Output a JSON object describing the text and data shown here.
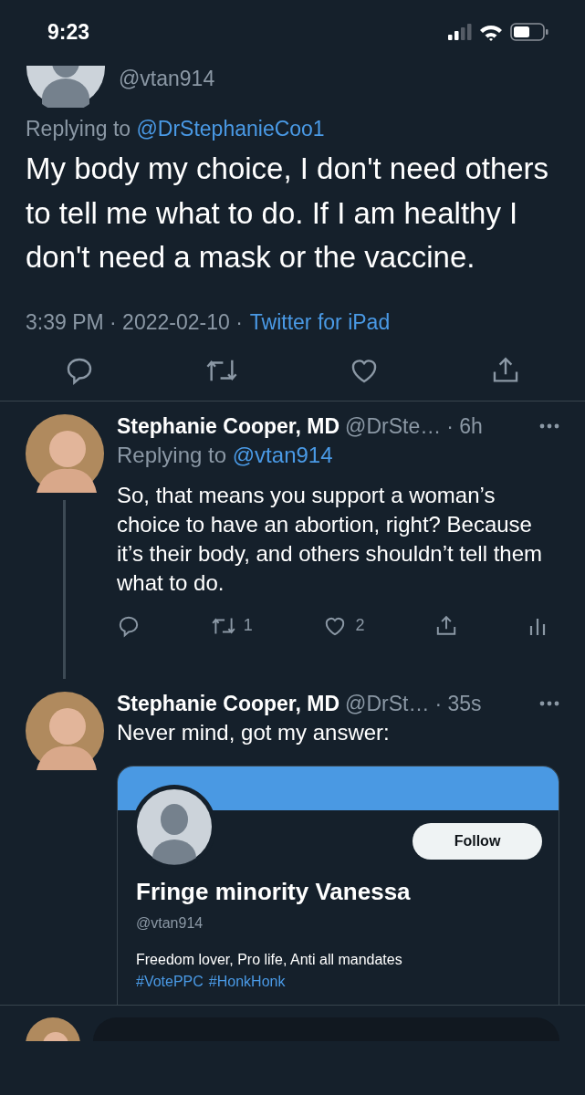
{
  "status_bar": {
    "time": "9:23"
  },
  "main_tweet": {
    "handle": "@vtan914",
    "replying_label": "Replying to",
    "replying_to": "@DrStephanieCoo1",
    "text": "My body my choice, I don't need others to tell me what to do. If I am healthy I don't need a mask or the vaccine.",
    "timestamp": "3:39 PM · 2022-02-10 ·",
    "source": "Twitter for iPad"
  },
  "replies": [
    {
      "name": "Stephanie Cooper, MD",
      "handle": "@DrSte…",
      "time": "· 6h",
      "replying_label": "Replying to",
      "replying_to": "@vtan914",
      "text": "So, that means you support a woman’s choice to have an abortion, right? Because it’s their body, and others shouldn’t tell them what to do.",
      "thread_line": true,
      "actions": {
        "retweets": "1",
        "likes": "2"
      }
    },
    {
      "name": "Stephanie Cooper, MD",
      "handle": "@DrSt…",
      "time": "· 35s",
      "text": "Never mind, got my answer:",
      "thread_line": false,
      "embed": {
        "follow_label": "Follow",
        "name": "Fringe minority Vanessa",
        "handle": "@vtan914",
        "bio": "Freedom lover, Pro life, Anti all mandates",
        "hashtags": [
          "#VotePPC",
          "#HonkHonk"
        ]
      }
    }
  ]
}
